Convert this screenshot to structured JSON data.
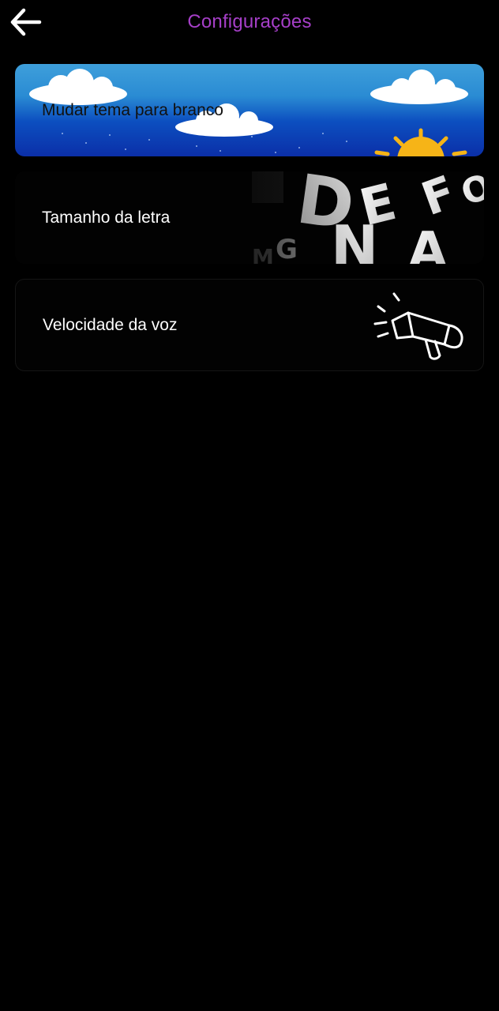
{
  "header": {
    "title": "Configurações",
    "back_icon": "arrow-left-icon",
    "title_color": "#a63fc8"
  },
  "settings": {
    "theme": {
      "label": "Mudar tema para branco",
      "icon": "sky-clouds-sun-icon"
    },
    "font_size": {
      "label": "Tamanho da letra",
      "icon": "letters-art-icon"
    },
    "voice_speed": {
      "label": "Velocidade da voz",
      "icon": "megaphone-icon"
    }
  }
}
